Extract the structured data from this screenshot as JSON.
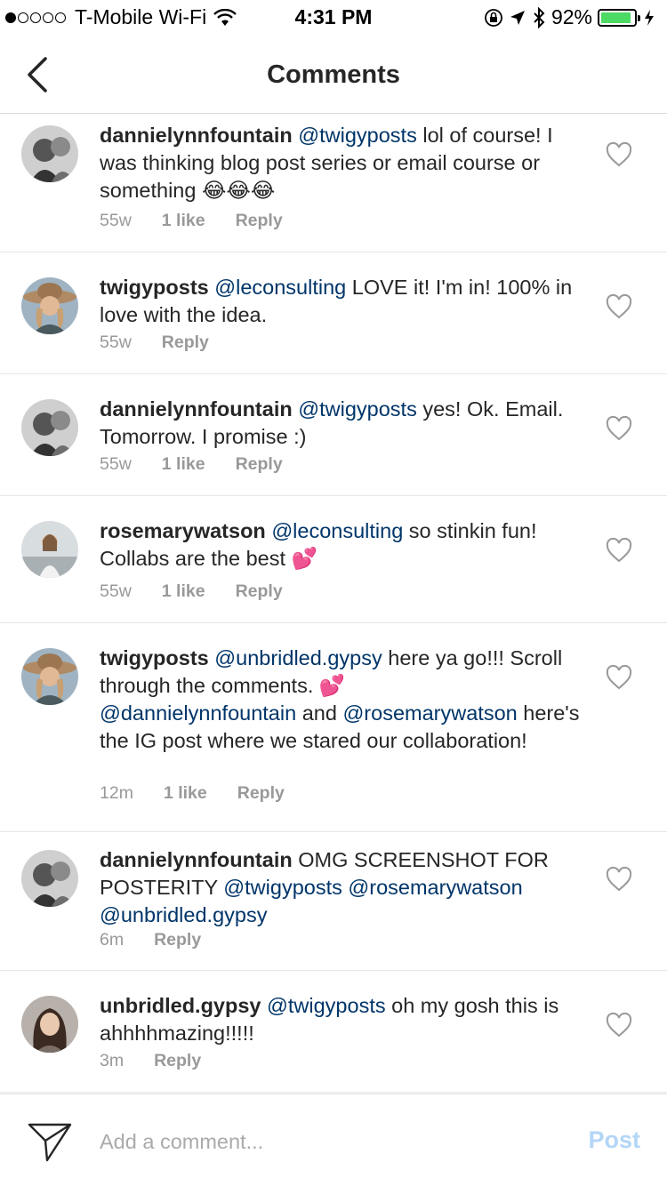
{
  "status_bar": {
    "carrier": "T-Mobile Wi-Fi",
    "time": "4:31 PM",
    "battery": "92%",
    "battery_level": 0.92,
    "battery_color": "#4cd964"
  },
  "nav": {
    "back_icon": "chevron-left-icon",
    "title": "Comments"
  },
  "comments": [
    {
      "username": "dannielynnfountain",
      "mention": "@twigyposts",
      "text": " lol of course! I was thinking blog post series or email course or something ",
      "emoji": "😂😂😂",
      "age": "55w",
      "likes": "1 like",
      "reply": "Reply"
    },
    {
      "username": "twigyposts",
      "mention": "@leconsulting",
      "text": " LOVE it! I'm in! 100% in love with the idea.",
      "age": "55w",
      "reply": "Reply"
    },
    {
      "username": "dannielynnfountain",
      "mention": "@twigyposts",
      "text": " yes! Ok. Email. Tomorrow. I promise :)",
      "age": "55w",
      "likes": "1 like",
      "reply": "Reply"
    },
    {
      "username": "rosemarywatson",
      "mention": "@leconsulting",
      "text": " so stinkin fun! Collabs are the best ",
      "emoji": "💕",
      "age": "55w",
      "likes": "1 like",
      "reply": "Reply"
    },
    {
      "username": "twigyposts",
      "mention": "@unbridled.gypsy",
      "text": " here ya go!!! Scroll through the comments. ",
      "emoji": "💕",
      "mention2": "@dannielynnfountain",
      "text2": " and ",
      "mention3": "@rosemarywatson",
      "text3": " here's the IG post where we stared our collaboration!",
      "age": "12m",
      "likes": "1 like",
      "reply": "Reply"
    },
    {
      "username": "dannielynnfountain",
      "text": " OMG SCREENSHOT FOR POSTERITY ",
      "mention": "@twigyposts",
      "mention2": "@rosemarywatson",
      "mention3": "@unbridled.gypsy",
      "age": "6m",
      "reply": "Reply"
    },
    {
      "username": "unbridled.gypsy",
      "mention": "@twigyposts",
      "text": " oh my gosh this is ahhhhmazing!!!!!",
      "age": "3m",
      "reply": "Reply"
    }
  ],
  "comment_bar": {
    "placeholder": "Add a comment...",
    "post_label": "Post",
    "post_color": "#b3d6f7"
  }
}
